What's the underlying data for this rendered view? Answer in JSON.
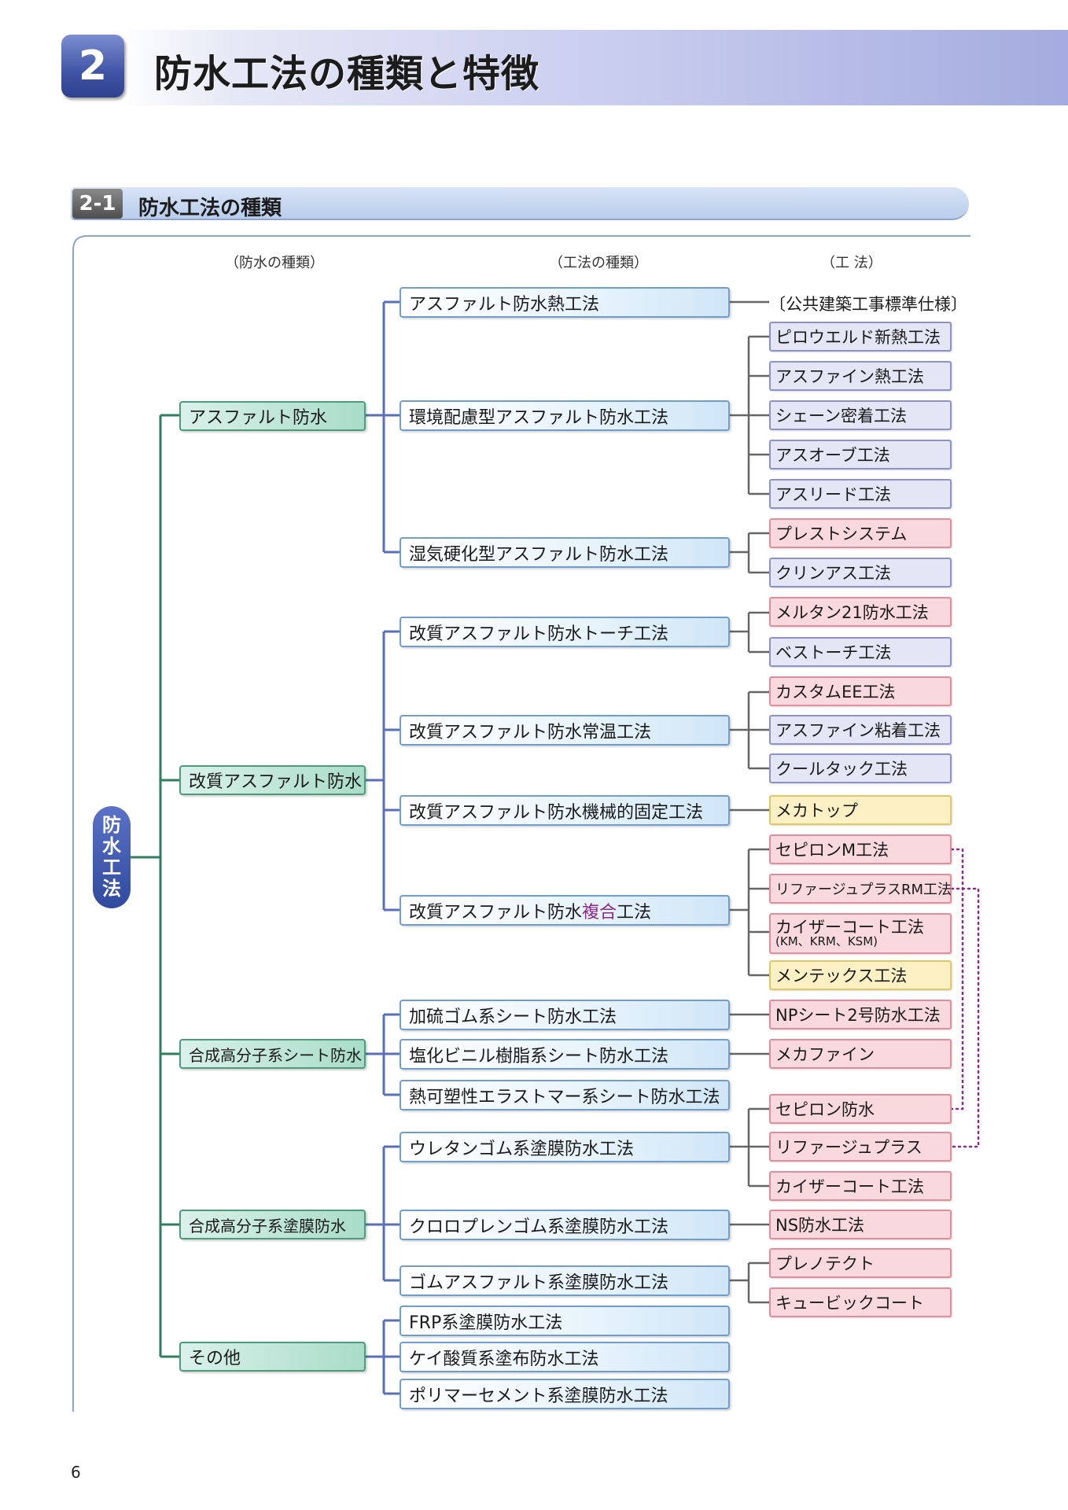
{
  "header": {
    "number": "2",
    "title": "防水工法の種類と特徴"
  },
  "section": {
    "number": "2-1",
    "title": "防水工法の種類"
  },
  "columns": {
    "type": "（防水の種類）",
    "method": "（工法の種類）",
    "construction": "（工 法）"
  },
  "root": [
    "防",
    "水",
    "工",
    "法"
  ],
  "categories": [
    "アスファルト防水",
    "改質アスファルト防水",
    "合成高分子系シート防水",
    "合成高分子系塗膜防水",
    "その他"
  ],
  "methods": [
    "アスファルト防水熱工法",
    "環境配慮型アスファルト防水工法",
    "湿気硬化型アスファルト防水工法",
    "改質アスファルト防水トーチ工法",
    "改質アスファルト防水常温工法",
    "改質アスファルト防水機械的固定工法",
    {
      "pre": "改質アスファルト防水",
      "hl": "複合",
      "post": "工法"
    },
    "加硫ゴム系シート防水工法",
    "塩化ビニル樹脂系シート防水工法",
    "熱可塑性エラストマー系シート防水工法",
    "ウレタンゴム系塗膜防水工法",
    "クロロプレンゴム系塗膜防水工法",
    "ゴムアスファルト系塗膜防水工法",
    "FRP系塗膜防水工法",
    "ケイ酸質系塗布防水工法",
    "ポリマーセメント系塗膜防水工法"
  ],
  "constructions": {
    "public": "〔公共建築工事標準仕様〕",
    "items": [
      "ピロウエルド新熱工法",
      "アスファイン熱工法",
      "シェーン密着工法",
      "アスオーブ工法",
      "アスリード工法",
      "プレストシステム",
      "クリンアス工法",
      "メルタン21防水工法",
      "ベストーチ工法",
      "カスタムEE工法",
      "アスファイン粘着工法",
      "クールタック工法",
      "メカトップ",
      "セピロンM工法",
      "リファージュプラスRM工法",
      "カイザーコート工法",
      "メンテックス工法",
      "NPシート2号防水工法",
      "メカファイン",
      "セピロン防水",
      "リファージュプラス",
      "カイザーコート工法",
      "NS防水工法",
      "プレノテクト",
      "キュービックコート"
    ],
    "kaiser_sub": "(KM、KRM、KSM)"
  },
  "colors": {
    "green": "#2f7d5f",
    "blue": "#5a6fb8",
    "gray": "#666666",
    "purple": "#8a2a8a",
    "frame": "#8aa4cc"
  },
  "page_number": "6"
}
